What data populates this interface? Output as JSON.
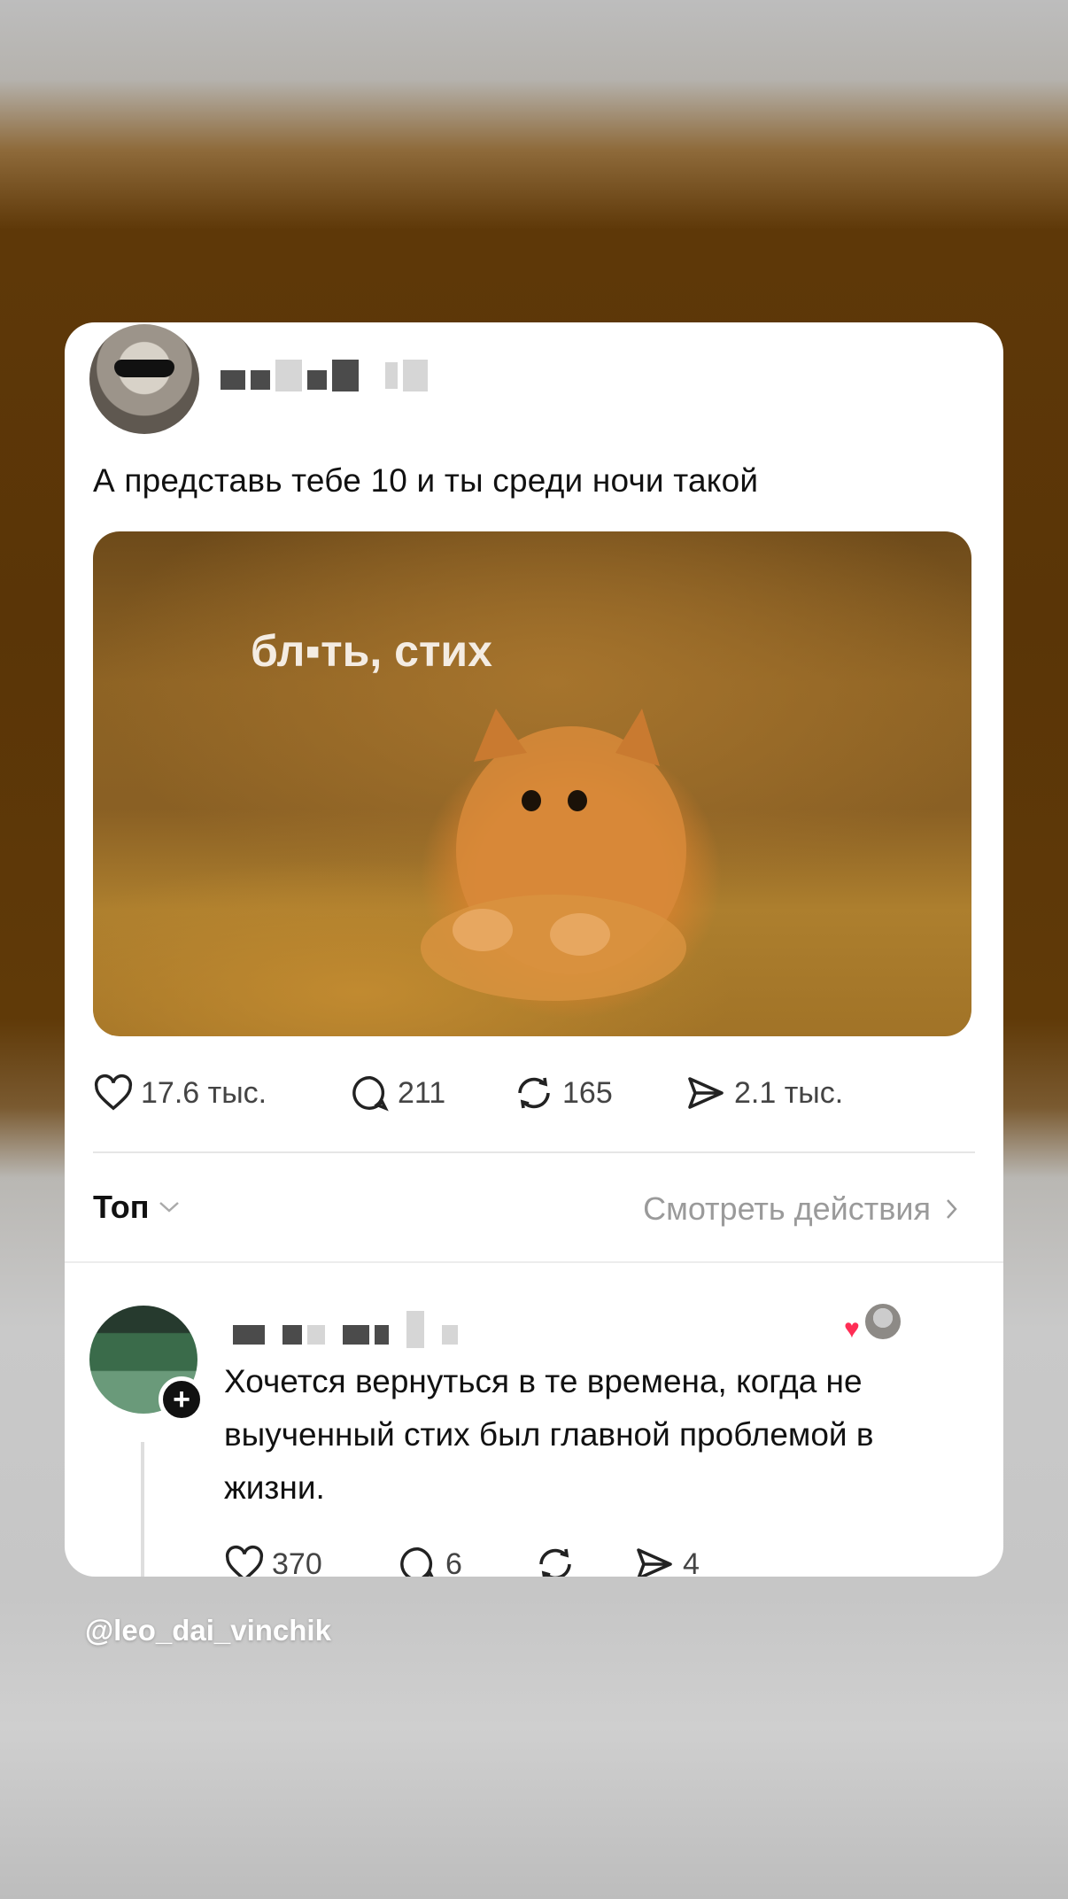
{
  "post": {
    "text": "А представь тебе 10 и ты среди ночи такой",
    "image_caption": "бл▪ть, стих",
    "stats": {
      "likes": "17.6 тыс.",
      "comments": "211",
      "reposts": "165",
      "shares": "2.1 тыс."
    }
  },
  "sort": {
    "label": "Топ",
    "view_actions": "Смотреть действия"
  },
  "reply": {
    "text": "Хочется вернуться в те времена, когда не выученный стих был главной проблемой в жизни.",
    "stats": {
      "likes": "370",
      "comments": "6",
      "shares": "4"
    }
  },
  "watermark": "@leo_dai_vinchik",
  "icons": [
    "heart-icon",
    "comment-icon",
    "repost-icon",
    "share-icon",
    "chevron-down-icon",
    "chevron-right-icon",
    "plus-icon"
  ]
}
